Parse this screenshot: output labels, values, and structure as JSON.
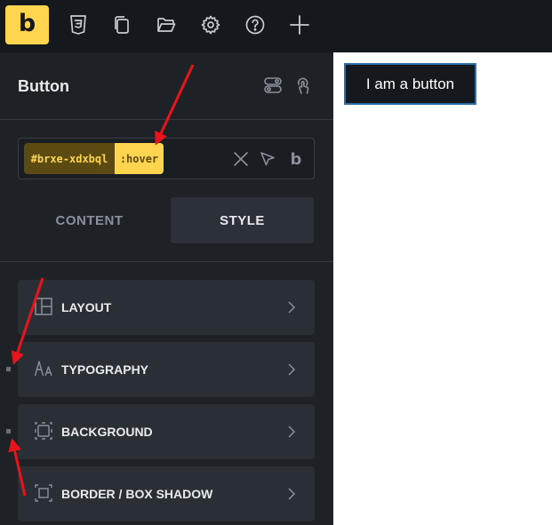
{
  "toolbar": {
    "logo": "b",
    "icons": [
      "css3-icon",
      "pages-icon",
      "folder-icon",
      "settings-icon",
      "help-icon",
      "add-icon"
    ]
  },
  "panel": {
    "title": "Button",
    "selector": {
      "id": "#brxe-xdxbql",
      "state": ":hover",
      "class_badge": "b"
    },
    "tabs": {
      "content": "CONTENT",
      "style": "STYLE",
      "active": "style"
    },
    "groups": [
      {
        "label": "LAYOUT",
        "icon": "layout-icon"
      },
      {
        "label": "TYPOGRAPHY",
        "icon": "typography-icon"
      },
      {
        "label": "BACKGROUND",
        "icon": "background-icon"
      },
      {
        "label": "BORDER / BOX SHADOW",
        "icon": "border-icon"
      }
    ]
  },
  "canvas": {
    "button_text": "I am a button"
  },
  "colors": {
    "accent": "#ffd54f",
    "toolbar_bg": "#15181c",
    "panel_bg": "#1e2227",
    "group_bg": "#2a2f36",
    "annotation": "#e8141c"
  }
}
